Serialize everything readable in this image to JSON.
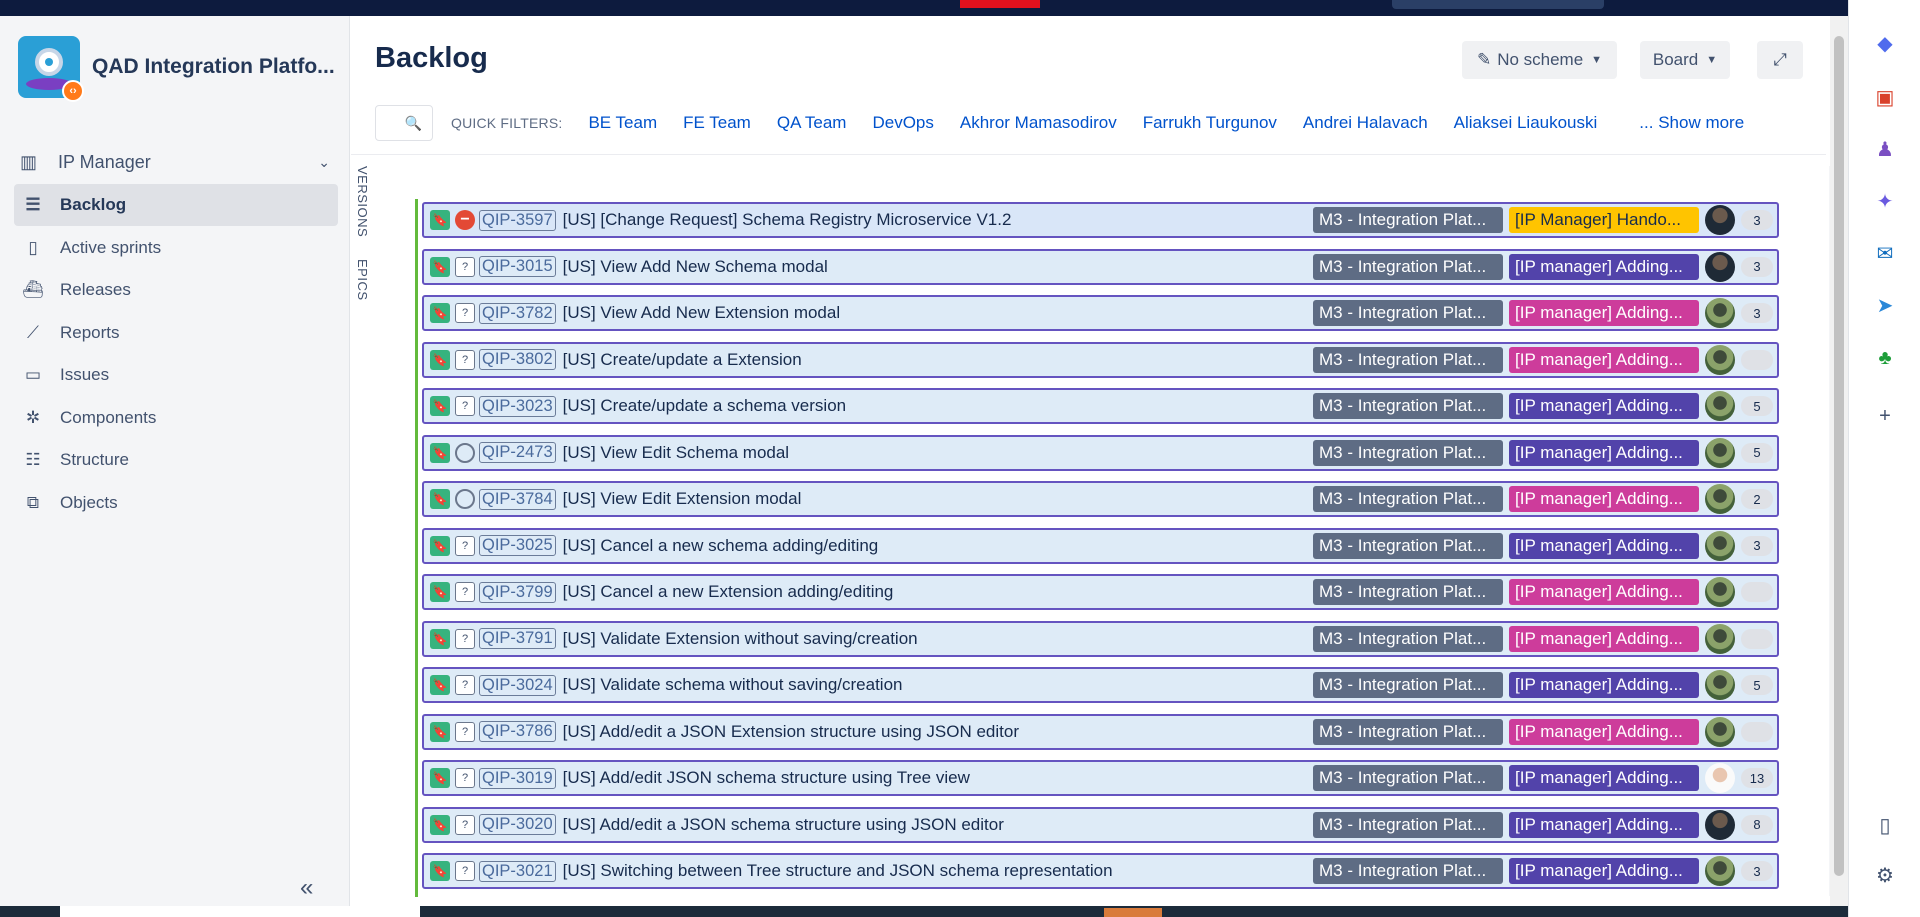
{
  "colors": {
    "version_lozenge": "#5e6c84",
    "epic_purple": "#5243aa",
    "epic_magenta": "#cd3c9b",
    "epic_yellow": "#ffc400",
    "story_green": "#36b37e",
    "card_border": "#6554c0",
    "link_blue": "#0052cc"
  },
  "topbar": {
    "logo": "QAD"
  },
  "sidebar": {
    "project_name": "QAD Integration Platfo...",
    "manager": {
      "label": "IP Manager",
      "icon": "board-icon"
    },
    "items": [
      {
        "label": "Backlog",
        "icon": "backlog-icon",
        "active": true
      },
      {
        "label": "Active sprints",
        "icon": "columns-icon"
      },
      {
        "label": "Releases",
        "icon": "ship-icon"
      },
      {
        "label": "Reports",
        "icon": "chart-icon"
      },
      {
        "label": "Issues",
        "icon": "issues-icon"
      },
      {
        "label": "Components",
        "icon": "puzzle-icon"
      },
      {
        "label": "Structure",
        "icon": "structure-icon"
      },
      {
        "label": "Objects",
        "icon": "objects-icon"
      }
    ],
    "collapse_icon": "«"
  },
  "header": {
    "title": "Backlog",
    "scheme_button": "No scheme",
    "board_button": "Board",
    "expand_icon": "expand-icon"
  },
  "filters": {
    "label": "QUICK FILTERS:",
    "items": [
      "BE Team",
      "FE Team",
      "QA Team",
      "DevOps",
      "Akhror Mamasodirov",
      "Farrukh Turgunov",
      "Andrei Halavach",
      "Aliaksei Liaukouski"
    ],
    "show_more": "... Show more"
  },
  "side_tabs": [
    "VERSIONS",
    "EPICS"
  ],
  "issues": [
    {
      "key": "QIP-3597",
      "summary": "[US] [Change Request] Schema Registry Microservice V1.2",
      "version": "M3 - Integration Plat...",
      "epic": "[IP Manager] Hando...",
      "epic_color": "yellow",
      "priority": "blocker",
      "avatar": "dark",
      "points": "3"
    },
    {
      "key": "QIP-3015",
      "summary": "[US] View Add New Schema modal",
      "version": "M3 - Integration Plat...",
      "epic": "[IP manager] Adding...",
      "epic_color": "purple",
      "priority": "unknown",
      "avatar": "dark",
      "points": "3"
    },
    {
      "key": "QIP-3782",
      "summary": "[US] View Add New Extension modal",
      "version": "M3 - Integration Plat...",
      "epic": "[IP manager] Adding...",
      "epic_color": "magenta",
      "priority": "unknown",
      "avatar": "green",
      "points": "3"
    },
    {
      "key": "QIP-3802",
      "summary": "[US] Create/update a Extension",
      "version": "M3 - Integration Plat...",
      "epic": "[IP manager] Adding...",
      "epic_color": "magenta",
      "priority": "unknown",
      "avatar": "green",
      "points": ""
    },
    {
      "key": "QIP-3023",
      "summary": "[US] Create/update a schema version",
      "version": "M3 - Integration Plat...",
      "epic": "[IP manager] Adding...",
      "epic_color": "purple",
      "priority": "unknown",
      "avatar": "green",
      "points": "5"
    },
    {
      "key": "QIP-2473",
      "summary": "[US] View Edit Schema modal",
      "version": "M3 - Integration Plat...",
      "epic": "[IP manager] Adding...",
      "epic_color": "purple",
      "priority": "circle",
      "avatar": "green",
      "points": "5"
    },
    {
      "key": "QIP-3784",
      "summary": "[US] View Edit Extension modal",
      "version": "M3 - Integration Plat...",
      "epic": "[IP manager] Adding...",
      "epic_color": "magenta",
      "priority": "circle",
      "avatar": "green",
      "points": "2"
    },
    {
      "key": "QIP-3025",
      "summary": "[US] Cancel a new schema adding/editing",
      "version": "M3 - Integration Plat...",
      "epic": "[IP manager] Adding...",
      "epic_color": "purple",
      "priority": "unknown",
      "avatar": "green",
      "points": "3"
    },
    {
      "key": "QIP-3799",
      "summary": "[US] Cancel a new Extension adding/editing",
      "version": "M3 - Integration Plat...",
      "epic": "[IP manager] Adding...",
      "epic_color": "magenta",
      "priority": "unknown",
      "avatar": "green",
      "points": ""
    },
    {
      "key": "QIP-3791",
      "summary": "[US] Validate Extension without saving/creation",
      "version": "M3 - Integration Plat...",
      "epic": "[IP manager] Adding...",
      "epic_color": "magenta",
      "priority": "unknown",
      "avatar": "green",
      "points": ""
    },
    {
      "key": "QIP-3024",
      "summary": "[US] Validate schema without saving/creation",
      "version": "M3 - Integration Plat...",
      "epic": "[IP manager] Adding...",
      "epic_color": "purple",
      "priority": "unknown",
      "avatar": "green",
      "points": "5"
    },
    {
      "key": "QIP-3786",
      "summary": "[US] Add/edit a JSON Extension structure using JSON editor",
      "version": "M3 - Integration Plat...",
      "epic": "[IP manager] Adding...",
      "epic_color": "magenta",
      "priority": "unknown",
      "avatar": "green",
      "points": ""
    },
    {
      "key": "QIP-3019",
      "summary": "[US] Add/edit JSON schema structure using Tree view",
      "version": "M3 - Integration Plat...",
      "epic": "[IP manager] Adding...",
      "epic_color": "purple",
      "priority": "unknown",
      "avatar": "face",
      "points": "13"
    },
    {
      "key": "QIP-3020",
      "summary": "[US] Add/edit a JSON schema structure using JSON editor",
      "version": "M3 - Integration Plat...",
      "epic": "[IP manager] Adding...",
      "epic_color": "purple",
      "priority": "unknown",
      "avatar": "dark",
      "points": "8"
    },
    {
      "key": "QIP-3021",
      "summary": "[US] Switching between Tree structure and JSON schema representation",
      "version": "M3 - Integration Plat...",
      "epic": "[IP manager] Adding...",
      "epic_color": "purple",
      "priority": "unknown",
      "avatar": "green",
      "points": "3"
    }
  ]
}
